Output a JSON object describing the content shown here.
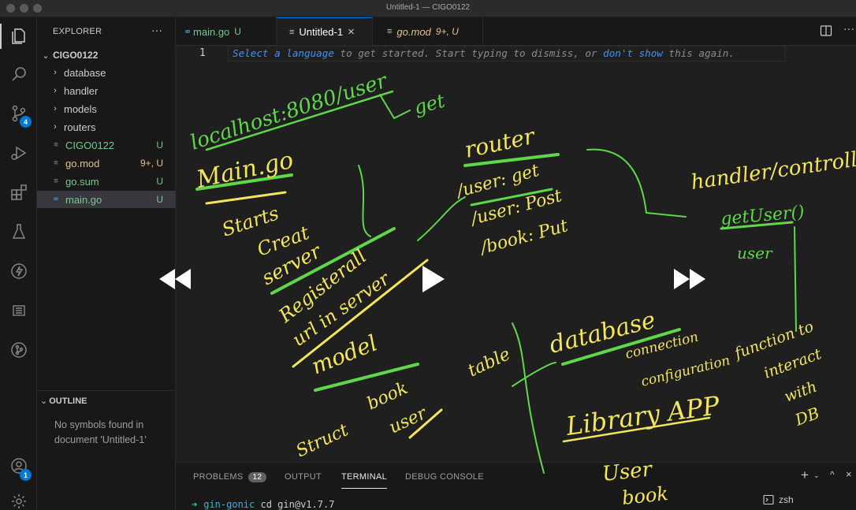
{
  "window": {
    "title": "Untitled-1 — CIGO0122"
  },
  "activity_bar": {
    "source_control_badge": "4",
    "accounts_badge": "1",
    "icons": [
      "files-icon",
      "search-icon",
      "source-control-icon",
      "run-debug-icon",
      "extensions-icon",
      "testing-icon",
      "lightning-icon",
      "list-icon",
      "git-graph-icon",
      "account-icon",
      "settings-gear-icon"
    ]
  },
  "explorer": {
    "header": "EXPLORER",
    "more": "···",
    "project": "CIGO0122",
    "folders": [
      "database",
      "handler",
      "models",
      "routers"
    ],
    "files": [
      {
        "name": "CIGO0122",
        "status": "U"
      },
      {
        "name": "go.mod",
        "status": "9+, U"
      },
      {
        "name": "go.sum",
        "status": "U"
      },
      {
        "name": "main.go",
        "status": "U"
      }
    ]
  },
  "outline": {
    "header": "OUTLINE",
    "message": "No symbols found in document 'Untitled-1'"
  },
  "tabs": [
    {
      "label": "main.go",
      "mark": "U"
    },
    {
      "label": "Untitled-1",
      "mark": "×"
    },
    {
      "label": "go.mod",
      "mark": "9+, U"
    }
  ],
  "editor": {
    "line_number": "1",
    "hint_pre": "Select a language",
    "hint_mid": " to get started. Start typing to dismiss, or ",
    "hint_link": "don't show",
    "hint_post": " this again."
  },
  "panel": {
    "tabs": [
      "PROBLEMS",
      "OUTPUT",
      "TERMINAL",
      "DEBUG CONSOLE"
    ],
    "problems_count": "12",
    "terminal_prompt": "➜",
    "terminal_dir": "gin-gonic",
    "terminal_cmd": "cd gin@v1.7.7",
    "shell": "zsh"
  },
  "annotations": {
    "url": "localhost:8080/user",
    "get": "get",
    "main": "Main.go",
    "starts": "Starts",
    "create": "Creat",
    "server": "server",
    "register": "Registerall",
    "url_in_server": "url in server",
    "model": "model",
    "router": "router",
    "route1": "/user: get",
    "route2": "/user: Post",
    "route3": "/book: Put",
    "handler": "handler/controller",
    "getuser": "getUser()",
    "user": "user",
    "database": "database",
    "db_note1": "connection",
    "db_note2": "configuration",
    "function_to": "function to",
    "interact": "interact",
    "with": "with",
    "db": "DB",
    "library": "Library APP",
    "struct": "Struct",
    "book": "book",
    "user2": "user",
    "table": "table",
    "bottom_user": "User",
    "bottom_book": "book"
  },
  "colors": {
    "accent": "#0078d4",
    "pen_yellow": "#f4e65a",
    "pen_green": "#5ed84a"
  }
}
